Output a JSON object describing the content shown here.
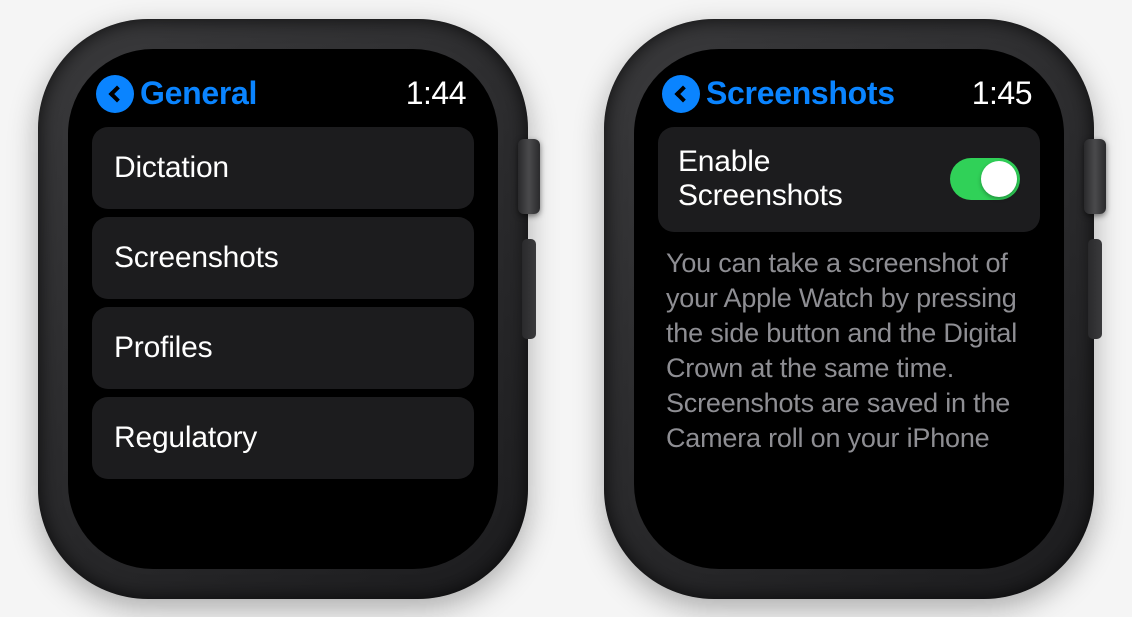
{
  "left": {
    "header": {
      "title": "General",
      "time": "1:44"
    },
    "menu": [
      {
        "label": "Dictation"
      },
      {
        "label": "Screenshots"
      },
      {
        "label": "Profiles"
      },
      {
        "label": "Regulatory"
      }
    ]
  },
  "right": {
    "header": {
      "title": "Screenshots",
      "time": "1:45"
    },
    "toggle": {
      "label": "Enable Screenshots",
      "on": true
    },
    "description": "You can take a screenshot of your Apple Watch by pressing the side button and the Digital Crown at the same time. Screenshots are saved in the Camera roll on your iPhone"
  }
}
